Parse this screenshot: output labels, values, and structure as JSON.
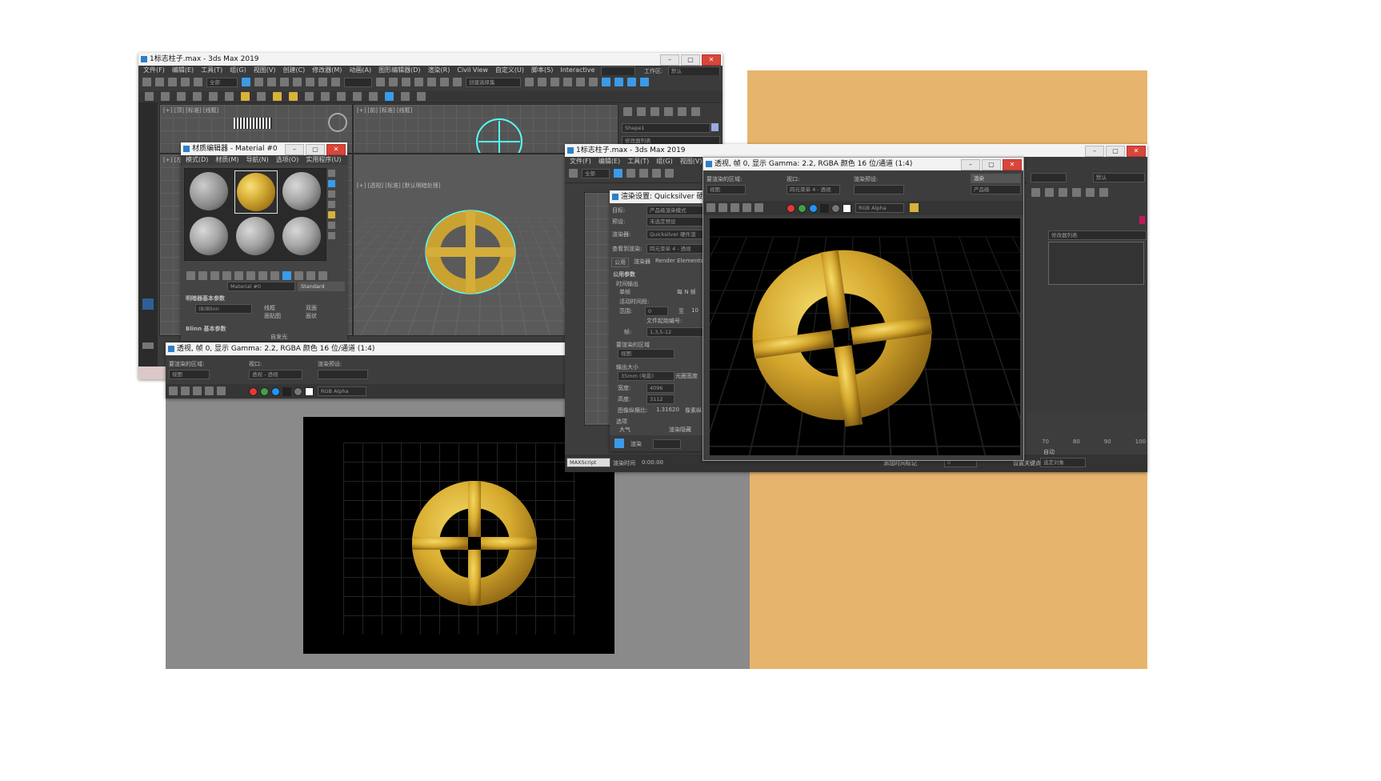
{
  "colors": {
    "background_panel": "#e7b46d",
    "gray_panel": "#8a8a8a",
    "max_dark": "#444444",
    "gold": "#d9b23a"
  },
  "main_window": {
    "title": "1标志柱子.max - 3ds Max 2019",
    "menu": [
      "文件(F)",
      "编辑(E)",
      "工具(T)",
      "组(G)",
      "视图(V)",
      "创建(C)",
      "修改器(M)",
      "动画(A)",
      "图形编辑器(D)",
      "渲染(R)",
      "Civil View",
      "自定义(U)",
      "脚本(S)",
      "Interactive"
    ],
    "workspace_label": "工作区:",
    "workspace_value": "默认",
    "top_viewport_label": "[+] [顶] [标准] [线框]",
    "front_viewport_label": "[+] [前] [标准] [线框]",
    "left_viewport_label": "[+] [左]",
    "persp_viewport_label": "[+] [透视] [标准] [默认明暗处理]",
    "selection_set": "全部",
    "create_selection": "创建选择集",
    "object_name": "Shape1",
    "modifier_list": "修改器列表"
  },
  "material_editor": {
    "title": "材质编辑器 - Material #0",
    "menu": [
      "模式(D)",
      "材质(M)",
      "导航(N)",
      "选项(O)",
      "实用程序(U)"
    ],
    "material_name": "Material #0",
    "material_type": "Standard",
    "rollout_shader": "明暗器基本参数",
    "shader_value": "(B)Blinn",
    "checkbox_wire": "线框",
    "checkbox_2sided": "双面",
    "checkbox_facemap": "面贴图",
    "checkbox_faceted": "面状",
    "rollout_blinn": "Blinn 基本参数",
    "self_illum": "自发光"
  },
  "front_render": {
    "title": "透视, 帧 0, 显示 Gamma: 2.2, RGBA 颜色 16 位/通道 (1:4)",
    "area_label": "要渲染的区域:",
    "area_value": "视图",
    "viewport_label": "视口:",
    "viewport_value": "透视 - 透视",
    "preset_label": "渲染预设:",
    "channel_value": "RGB Alpha"
  },
  "second_window": {
    "title": "1标志柱子.max - 3ds Max 2019",
    "menu": [
      "文件(F)",
      "编辑(E)",
      "工具(T)",
      "组(G)",
      "视图(V)"
    ],
    "selection_set": "全部",
    "status_left": "MAXScript",
    "render_time_label": "渲染时间",
    "render_time_value": "0:00:00",
    "add_time_tag": "添加时间标记",
    "set_key": "设置关键点",
    "selected": "选定对象",
    "auto_label": "自动",
    "frame_value": "0",
    "timeline_marks": [
      "70",
      "80",
      "90",
      "100"
    ]
  },
  "render_setup": {
    "title": "渲染设置: Quicksilver 硬件渲染器",
    "target_label": "目标:",
    "target_value": "产品级渲染模式",
    "preset_label": "预设:",
    "preset_value": "未选定预设",
    "renderer_label": "渲染器:",
    "renderer_value": "Quicksilver 硬件渲",
    "view_label": "查看到渲染:",
    "view_value": "四元菜单 4 - 透视",
    "tabs": [
      "公用",
      "渲染器",
      "Render Elements"
    ],
    "rollout": "公用参数",
    "time_output": "时间输出",
    "single": "单帧",
    "every_n": "每 N 帧",
    "active_segment": "活动时间段:",
    "range": "范围:",
    "range_from": "0",
    "range_to": "至",
    "range_end": "10",
    "file_number_base": "文件起始编号:",
    "frames_label": "帧:",
    "frames_value": "1,3,5-12",
    "area_label": "要渲染的区域",
    "area_value": "视图",
    "output_size": "输出大小",
    "size_preset": "35mm (电影)",
    "aperture": "光圈宽度",
    "width_label": "宽度:",
    "width_value": "4096",
    "height_label": "高度:",
    "height_value": "3112",
    "aspect_label": "图像纵横比:",
    "aspect_value": "1.31620",
    "pixel_aspect": "像素纵",
    "options": "选项",
    "atmosphere": "大气",
    "render_hidden": "渲染隐藏",
    "render_button": "渲染"
  },
  "persp_render": {
    "title": "透视, 帧 0, 显示 Gamma: 2.2, RGBA 颜色 16 位/通道 (1:4)",
    "area_label": "要渲染的区域:",
    "area_value": "视图",
    "viewport_label": "视口:",
    "viewport_value": "四元菜单 4 - 透视",
    "preset_label": "渲染预设:",
    "render_button": "渲染",
    "product_value": "产品级",
    "channel_value": "RGB Alpha"
  },
  "right_panel": {
    "workspace_value": "默认",
    "modifier_list": "修改器列表"
  }
}
